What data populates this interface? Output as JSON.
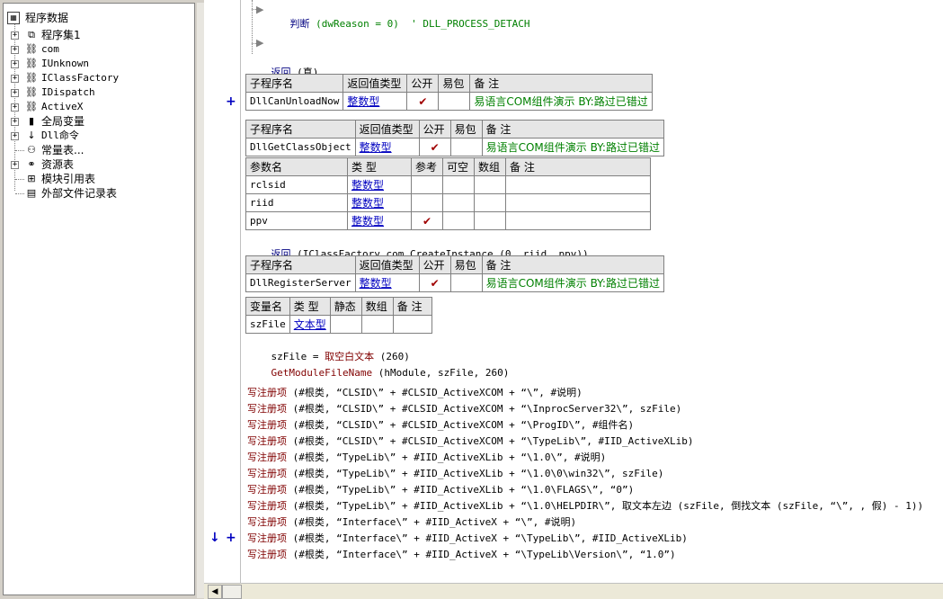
{
  "tree": {
    "root": "程序数据",
    "items": [
      {
        "label": "程序集1",
        "icon": "assembly-icon",
        "expander": "+"
      },
      {
        "label": "com",
        "icon": "class-icon",
        "expander": "+"
      },
      {
        "label": "IUnknown",
        "icon": "class-icon",
        "expander": "+"
      },
      {
        "label": "IClassFactory",
        "icon": "class-icon",
        "expander": "+"
      },
      {
        "label": "IDispatch",
        "icon": "class-icon",
        "expander": "+"
      },
      {
        "label": "ActiveX",
        "icon": "class-icon",
        "expander": "+"
      },
      {
        "label": "全局变量",
        "icon": "database-icon",
        "expander": "+"
      },
      {
        "label": "Dll命令",
        "icon": "dll-icon",
        "expander": "+"
      },
      {
        "label": "常量表...",
        "icon": "constant-icon",
        "expander": ""
      },
      {
        "label": "资源表",
        "icon": "resource-icon",
        "expander": "+"
      },
      {
        "label": "模块引用表",
        "icon": "module-icon",
        "expander": ""
      },
      {
        "label": "外部文件记录表",
        "icon": "file-icon",
        "expander": ""
      }
    ]
  },
  "code": {
    "line1": {
      "kw": "判断",
      "text": " (dwReason = 0)  ' DLL_PROCESS_DETACH"
    },
    "ret1": {
      "kw": "返回",
      "text": " (真)"
    },
    "sub1": {
      "headers": [
        "子程序名",
        "返回值类型",
        "公开",
        "易包",
        "备 注"
      ],
      "name": "DllCanUnloadNow",
      "type": "整数型",
      "public": "✔",
      "pack": "",
      "note": "易语言COM组件演示 BY:路过已错过"
    },
    "sub2": {
      "headers": [
        "子程序名",
        "返回值类型",
        "公开",
        "易包",
        "备 注"
      ],
      "name": "DllGetClassObject",
      "type": "整数型",
      "public": "✔",
      "pack": "",
      "note": "易语言COM组件演示 BY:路过已错过",
      "param_headers": [
        "参数名",
        "类 型",
        "参考",
        "可空",
        "数组",
        "备 注"
      ],
      "params": [
        {
          "name": "rclsid",
          "type": "整数型",
          "ref": ""
        },
        {
          "name": "riid",
          "type": "整数型",
          "ref": ""
        },
        {
          "name": "ppv",
          "type": "整数型",
          "ref": "✔"
        }
      ]
    },
    "ret2": {
      "kw": "返回",
      "text": " (IClassFactory_com.CreateInstance (0, riid, ppv))"
    },
    "sub3": {
      "headers": [
        "子程序名",
        "返回值类型",
        "公开",
        "易包",
        "备 注"
      ],
      "name": "DllRegisterServer",
      "type": "整数型",
      "public": "✔",
      "pack": "",
      "note": "易语言COM组件演示 BY:路过已错过"
    },
    "var_table": {
      "headers": [
        "变量名",
        "类 型",
        "静态",
        "数组",
        "备 注"
      ],
      "name": "szFile",
      "type": "文本型"
    },
    "assign": {
      "lhs": "szFile = ",
      "fn": "取空白文本",
      "rest": " (260)"
    },
    "getmod": {
      "fn": "GetModuleFileName",
      "rest": " (hModule, szFile, 260)"
    },
    "reg_fn": "写注册项",
    "reg_lines": [
      "(#根类, “CLSID\\” + #CLSID_ActiveXCOM + “\\”, #说明)",
      "(#根类, “CLSID\\” + #CLSID_ActiveXCOM + “\\InprocServer32\\”, szFile)",
      "(#根类, “CLSID\\” + #CLSID_ActiveXCOM + “\\ProgID\\”, #组件名)",
      "(#根类, “CLSID\\” + #CLSID_ActiveXCOM + “\\TypeLib\\”, #IID_ActiveXLib)",
      "(#根类, “TypeLib\\” + #IID_ActiveXLib + “\\1.0\\”, #说明)",
      "(#根类, “TypeLib\\” + #IID_ActiveXLib + “\\1.0\\0\\win32\\”, szFile)",
      "(#根类, “TypeLib\\” + #IID_ActiveXLib + “\\1.0\\FLAGS\\”, “0”)",
      "(#根类, “TypeLib\\” + #IID_ActiveXLib + “\\1.0\\HELPDIR\\”, 取文本左边 (szFile, 倒找文本 (szFile, “\\”, , 假) - 1))",
      "(#根类, “Interface\\” + #IID_ActiveX + “\\”, #说明)",
      "(#根类, “Interface\\” + #IID_ActiveX + “\\TypeLib\\”, #IID_ActiveXLib)",
      "(#根类, “Interface\\” + #IID_ActiveX + “\\TypeLib\\Version\\”, “1.0”)"
    ]
  },
  "gutter": {
    "plus": "+",
    "arrow": "↓"
  },
  "scroll": {
    "left": "◀"
  }
}
